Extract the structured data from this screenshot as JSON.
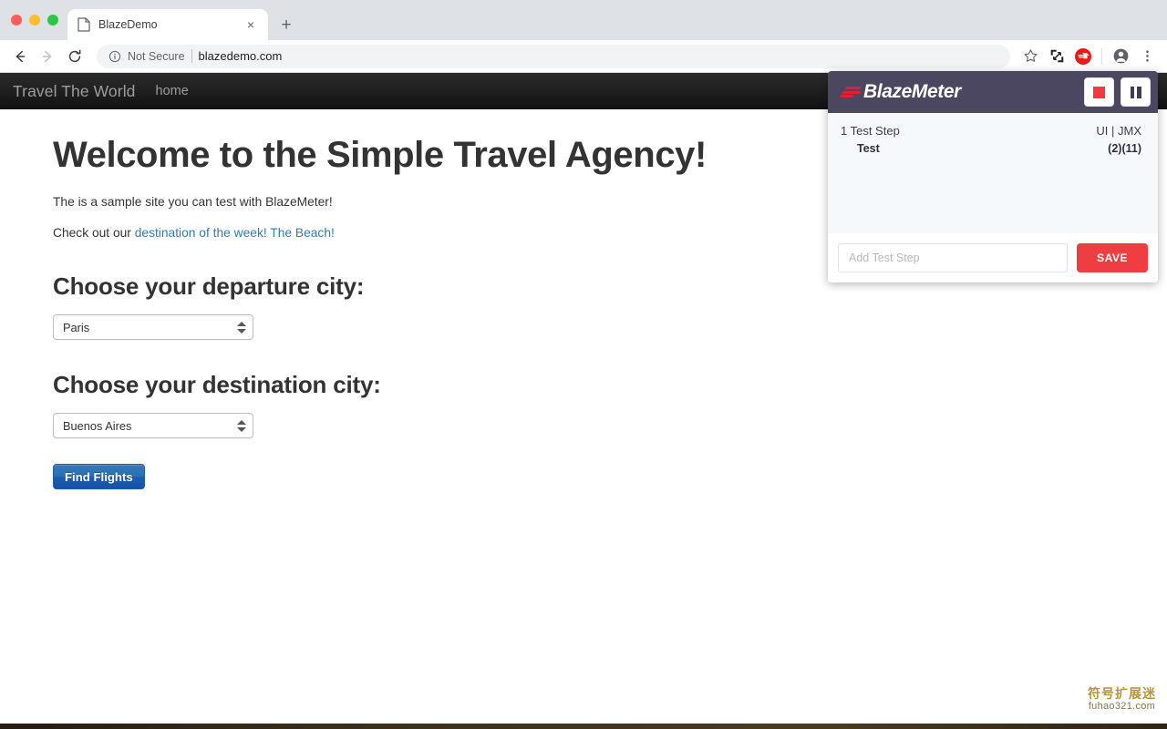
{
  "browser": {
    "tab": {
      "title": "BlazeDemo",
      "favicon_icon": "page-icon",
      "close_icon": "×"
    },
    "new_tab_icon": "+",
    "nav": {
      "back_icon": "←",
      "forward_icon": "→",
      "reload_icon": "⟳"
    },
    "omnibox": {
      "info_icon": "ⓘ",
      "security_label": "Not Secure",
      "url": "blazedemo.com"
    },
    "toolbar_icons": {
      "bookmark_star": "☆",
      "screenshot": "screenshot-icon",
      "extension_blazemeter": "B",
      "profile": "profile-icon",
      "menu": "⋮"
    }
  },
  "site": {
    "navbar": {
      "brand": "Travel The World",
      "links": [
        "home"
      ]
    },
    "heading": "Welcome to the Simple Travel Agency!",
    "paragraph_1": "The is a sample site you can test with BlazeMeter!",
    "paragraph_2_prefix": "Check out our ",
    "paragraph_2_link": "destination of the week! The Beach!",
    "departure": {
      "label": "Choose your departure city:",
      "value": "Paris"
    },
    "destination": {
      "label": "Choose your destination city:",
      "value": "Buenos Aires"
    },
    "submit_label": "Find Flights"
  },
  "blazemeter_panel": {
    "logo_text": "BlazeMeter",
    "stop_icon": "stop-icon",
    "pause_icon": "pause-icon",
    "steps_count": "1 Test Step",
    "step_name": "Test",
    "meta_top": "UI | JMX",
    "meta_bottom": "(2)(11)",
    "add_step_placeholder": "Add Test Step",
    "save_label": "SAVE",
    "colors": {
      "header_bg": "#4b4760",
      "body_bg": "#f6f9fc",
      "accent_red": "#ef3e42",
      "stop_red": "#f4383f",
      "pause_dark": "#3e3d56"
    }
  },
  "watermark": {
    "chinese": "符号扩展迷",
    "domain": "fuhao321.com"
  }
}
